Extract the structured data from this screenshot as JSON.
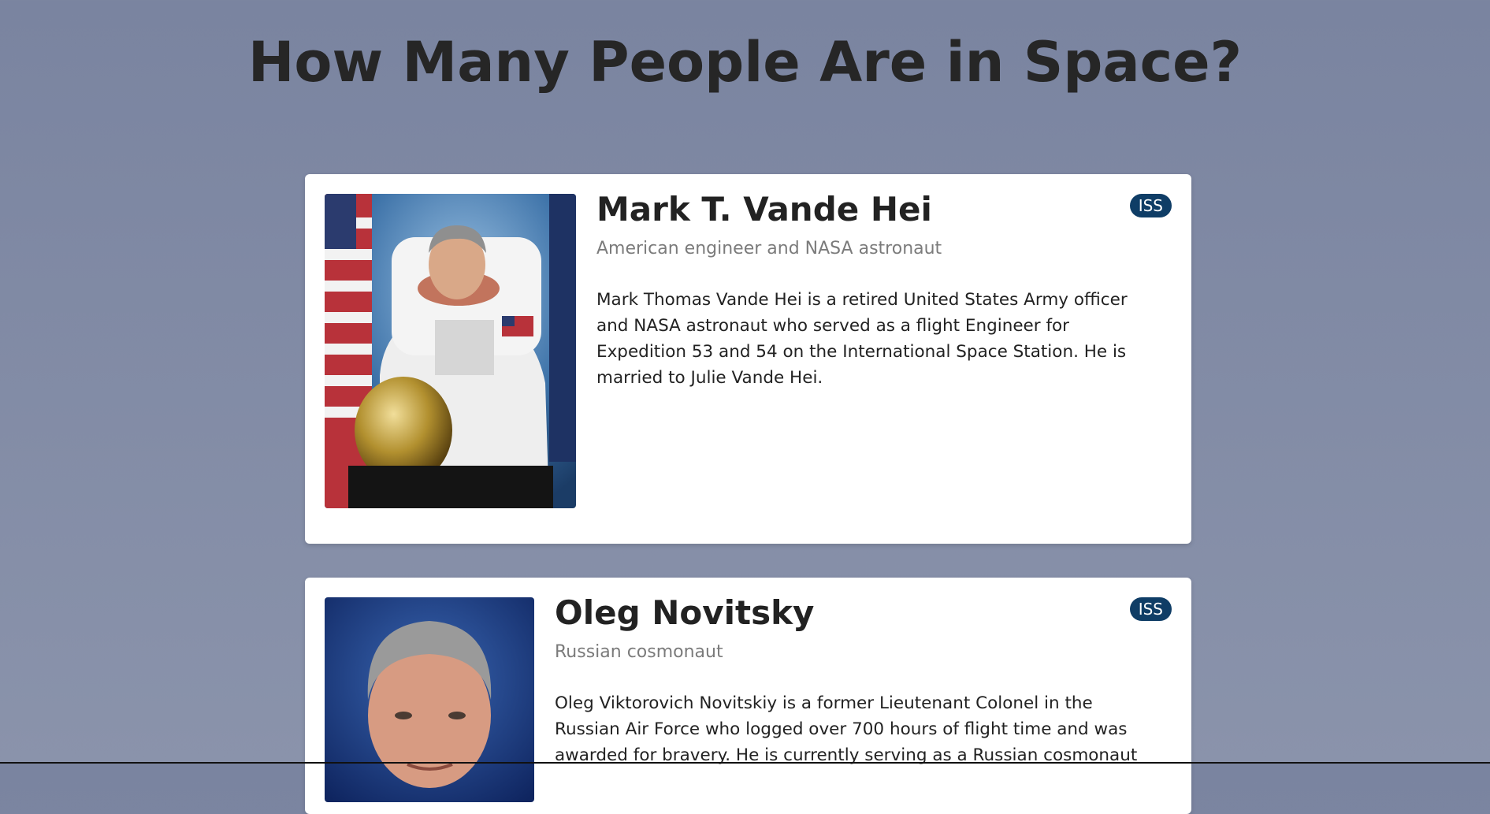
{
  "page": {
    "title": "How Many People Are in Space?"
  },
  "astronauts": [
    {
      "name": "Mark T. Vande Hei",
      "role": "American engineer and NASA astronaut",
      "bio": "Mark Thomas Vande Hei is a retired United States Army officer and NASA astronaut who served as a flight Engineer for Expedition 53 and 54 on the International Space Station. He is married to Julie Vande Hei.",
      "craft": "ISS"
    },
    {
      "name": "Oleg Novitsky",
      "role": "Russian cosmonaut",
      "bio": "Oleg Viktorovich Novitskiy is a former Lieutenant Colonel in the Russian Air Force who logged over 700 hours of flight time and was awarded for bravery. He is currently serving as a Russian cosmonaut",
      "craft": "ISS"
    }
  ],
  "colors": {
    "background": "#7f88a3",
    "badge": "#0f3d66",
    "card": "#ffffff"
  }
}
